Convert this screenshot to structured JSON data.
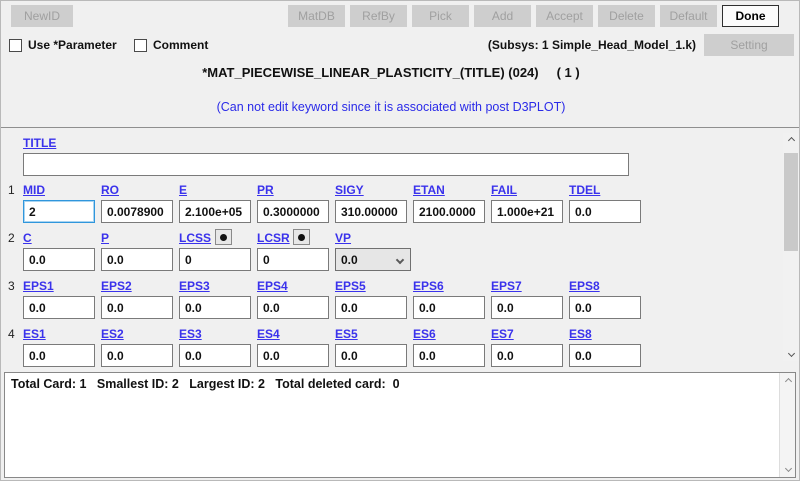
{
  "toolbar": {
    "newid": {
      "label": "NewID",
      "enabled": false
    },
    "right_buttons": [
      {
        "name": "matdb",
        "label": "MatDB",
        "enabled": false
      },
      {
        "name": "refby",
        "label": "RefBy",
        "enabled": false
      },
      {
        "name": "pick",
        "label": "Pick",
        "enabled": false
      },
      {
        "name": "add",
        "label": "Add",
        "enabled": false
      },
      {
        "name": "accept",
        "label": "Accept",
        "enabled": false
      },
      {
        "name": "delete",
        "label": "Delete",
        "enabled": false
      },
      {
        "name": "default",
        "label": "Default",
        "enabled": false
      },
      {
        "name": "done",
        "label": "Done",
        "enabled": true
      }
    ]
  },
  "options": {
    "use_parameter_label": "Use *Parameter",
    "use_parameter_checked": false,
    "comment_label": "Comment",
    "comment_checked": false,
    "subsys_text": "(Subsys: 1 Simple_Head_Model_1.k)",
    "setting_label": "Setting",
    "setting_enabled": false
  },
  "keyword": {
    "heading": "*MAT_PIECEWISE_LINEAR_PLASTICITY_(TITLE) (024)",
    "count": "( 1 )",
    "notice": "(Can not edit keyword since it is associated with post D3PLOT)"
  },
  "card": {
    "title_label": "TITLE",
    "title_value": "",
    "rows": [
      {
        "num": "1",
        "fields": [
          {
            "label": "MID",
            "value": "2",
            "focused": true
          },
          {
            "label": "RO",
            "value": "0.0078900"
          },
          {
            "label": "E",
            "value": "2.100e+05"
          },
          {
            "label": "PR",
            "value": "0.3000000"
          },
          {
            "label": "SIGY",
            "value": "310.00000"
          },
          {
            "label": "ETAN",
            "value": "2100.0000"
          },
          {
            "label": "FAIL",
            "value": "1.000e+21"
          },
          {
            "label": "TDEL",
            "value": "0.0"
          }
        ]
      },
      {
        "num": "2",
        "fields": [
          {
            "label": "C",
            "value": "0.0"
          },
          {
            "label": "P",
            "value": "0.0"
          },
          {
            "label": "LCSS",
            "value": "0",
            "dot": true
          },
          {
            "label": "LCSR",
            "value": "0",
            "dot": true
          },
          {
            "label": "VP",
            "value": "0.0",
            "dropdown": true
          }
        ]
      },
      {
        "num": "3",
        "fields": [
          {
            "label": "EPS1",
            "value": "0.0"
          },
          {
            "label": "EPS2",
            "value": "0.0"
          },
          {
            "label": "EPS3",
            "value": "0.0"
          },
          {
            "label": "EPS4",
            "value": "0.0"
          },
          {
            "label": "EPS5",
            "value": "0.0"
          },
          {
            "label": "EPS6",
            "value": "0.0"
          },
          {
            "label": "EPS7",
            "value": "0.0"
          },
          {
            "label": "EPS8",
            "value": "0.0"
          }
        ]
      },
      {
        "num": "4",
        "fields": [
          {
            "label": "ES1",
            "value": "0.0"
          },
          {
            "label": "ES2",
            "value": "0.0"
          },
          {
            "label": "ES3",
            "value": "0.0"
          },
          {
            "label": "ES4",
            "value": "0.0"
          },
          {
            "label": "ES5",
            "value": "0.0"
          },
          {
            "label": "ES6",
            "value": "0.0"
          },
          {
            "label": "ES7",
            "value": "0.0"
          },
          {
            "label": "ES8",
            "value": "0.0"
          }
        ]
      }
    ]
  },
  "status_bar": {
    "text": "Total Card: 1   Smallest ID: 2   Largest ID: 2   Total deleted card:  0"
  },
  "colors": {
    "link_blue": "#3a32ec",
    "notice_blue": "#2b2be8",
    "focus_border": "#2f96dc",
    "disabled_button_bg": "#cecece",
    "background": "#f0f0f0"
  }
}
